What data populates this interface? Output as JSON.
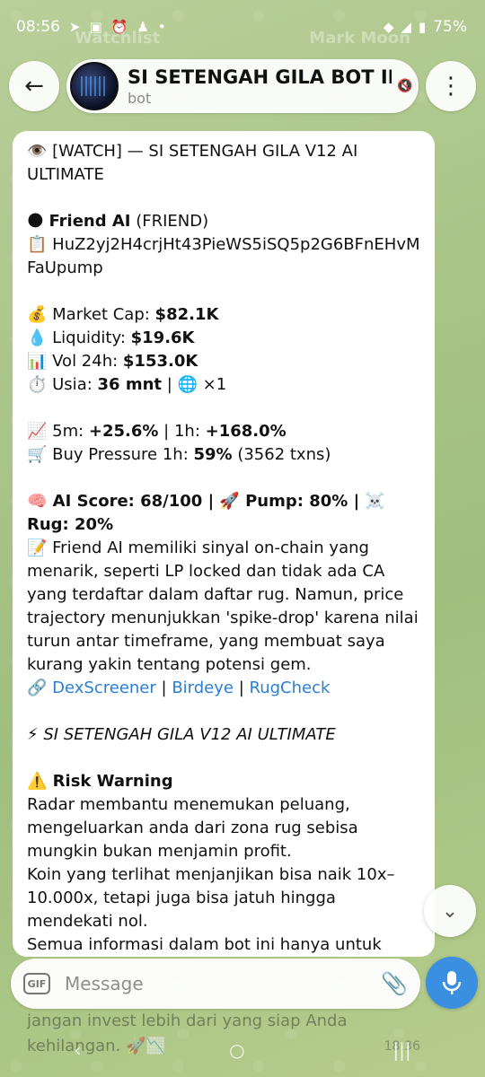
{
  "status_bar": {
    "time": "08:56",
    "battery": "75%"
  },
  "background_tabs": {
    "left": "Watchlist",
    "right": "Mark Moon"
  },
  "header": {
    "title": "SI SETENGAH GILA BOT INI",
    "subtitle": "bot"
  },
  "message": {
    "line1": "👁️ [WATCH] — SI SETENGAH GILA V12 AI ULTIMATE",
    "token_icon": "🌑",
    "token_name": "Friend AI",
    "token_symbol": "(FRIEND)",
    "ca_icon": "📋",
    "ca": "HuZ2yj2H4crjHt43PieWS5iSQ5p2G6BFnEHvMFaUpump",
    "mc_label": "💰 Market Cap: ",
    "mc_value": "$82.1K",
    "liq_label": "💧 Liquidity: ",
    "liq_value": "$19.6K",
    "vol_label": "📊 Vol 24h: ",
    "vol_value": "$153.0K",
    "age_label": "⏱️ Usia: ",
    "age_value": "36 mnt",
    "age_rest": " | 🌐 ×1",
    "change_icon": "📈",
    "change_5m_label": " 5m: ",
    "change_5m": "+25.6%",
    "change_1h_label": " | 1h: ",
    "change_1h": "+168.0%",
    "bp_label": "🛒 Buy Pressure 1h: ",
    "bp_value": "59%",
    "bp_rest": " (3562 txns)",
    "ai_line": "🧠 AI Score: 68/100 | 🚀 Pump: 80% | ☠️ Rug: 20%",
    "ai_text": "📝 Friend AI memiliki sinyal on-chain yang menarik, seperti LP locked dan tidak ada CA yang terdaftar dalam daftar rug. Namun, price trajectory menunjukkan 'spike-drop' karena nilai turun antar timeframe, yang membuat saya kurang yakin tentang potensi gem.",
    "link_icon": "🔗",
    "link1": "DexScreener",
    "link2": "Birdeye",
    "link3": "RugCheck",
    "sep": " | ",
    "signature": "⚡ SI SETENGAH GILA V12 AI ULTIMATE",
    "risk_title": "⚠️ Risk Warning",
    "risk_text1": "Radar membantu menemukan peluang, mengeluarkan anda dari zona rug sebisa mungkin bukan menjamin profit.",
    "risk_text2": "Koin yang terlihat menjanjikan bisa naik 10x–10.000x, tetapi juga bisa jatuh hingga mendekati nol.",
    "risk_text3": "Semua informasi dalam bot ini hanya untuk"
  },
  "peek": {
    "text": "jangan invest lebih dari yang siap Anda kehilangan. 🚀📉",
    "time": "18:36"
  },
  "composer": {
    "placeholder": "Message",
    "gif_label": "GIF"
  }
}
